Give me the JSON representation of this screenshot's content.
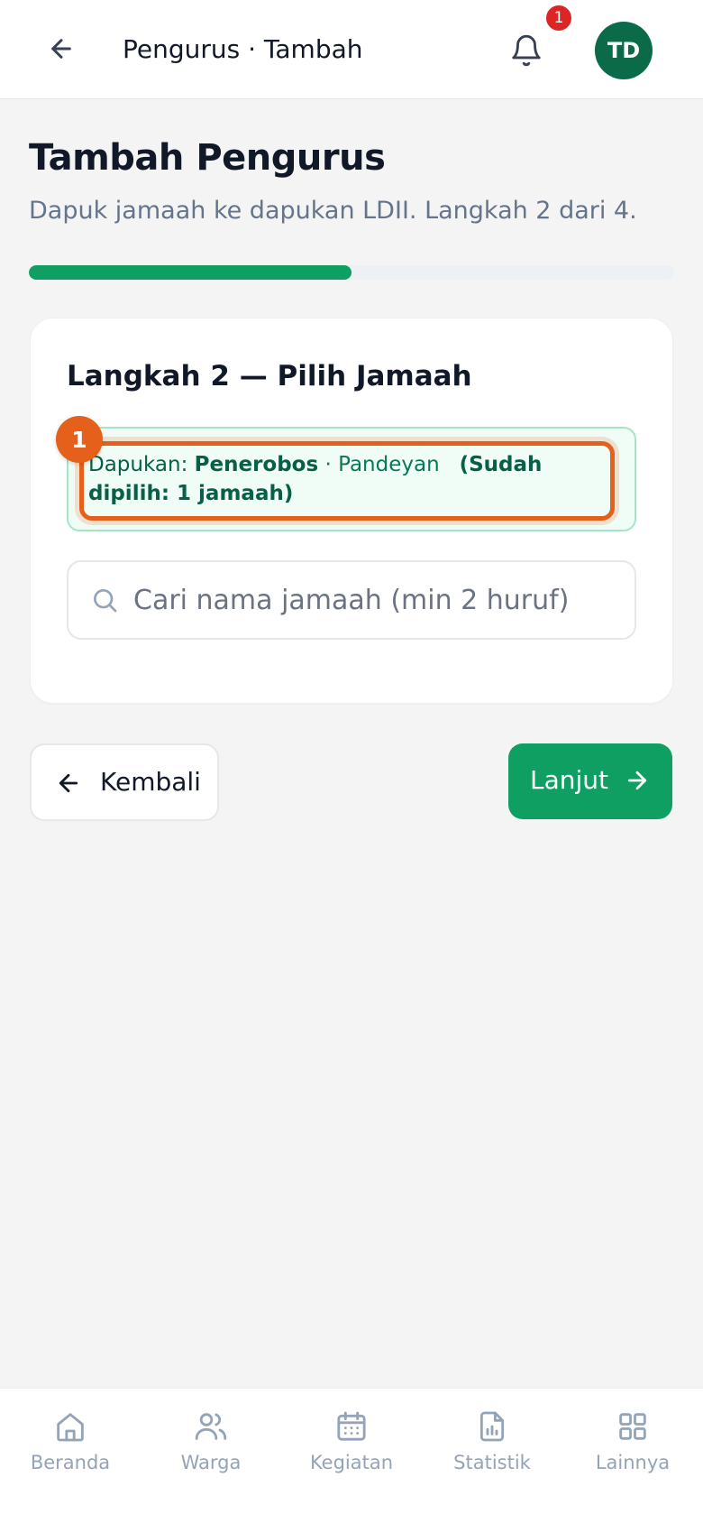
{
  "header": {
    "title": "Pengurus · Tambah",
    "notification_count": "1",
    "avatar_initials": "TD"
  },
  "page": {
    "title": "Tambah Pengurus",
    "subtitle": "Dapuk jamaah ke dapukan LDII. Langkah 2 dari 4.",
    "progress": {
      "current_step": 2,
      "total_steps": 4,
      "fraction": 0.5
    }
  },
  "card": {
    "title": "Langkah 2 — Pilih Jamaah",
    "step_marker": "1",
    "info": {
      "label": "Dapukan: ",
      "dapukan": "Penerobos",
      "separator": " · ",
      "location": "Pandeyan",
      "selected_count": "(Sudah dipilih: 1 jamaah)"
    },
    "search": {
      "placeholder": "Cari nama jamaah (min 2 huruf)",
      "value": ""
    }
  },
  "actions": {
    "back_label": "Kembali",
    "next_label": "Lanjut"
  },
  "bottom_nav": [
    {
      "label": "Beranda",
      "icon": "home-icon"
    },
    {
      "label": "Warga",
      "icon": "users-icon"
    },
    {
      "label": "Kegiatan",
      "icon": "calendar-icon"
    },
    {
      "label": "Statistik",
      "icon": "report-icon"
    },
    {
      "label": "Lainnya",
      "icon": "grid-icon"
    }
  ],
  "colors": {
    "primary": "#0f9f63",
    "avatar": "#0b6b49",
    "highlight": "#e5611b",
    "badge": "#dc2626",
    "info_bg": "#f0fdf7"
  }
}
